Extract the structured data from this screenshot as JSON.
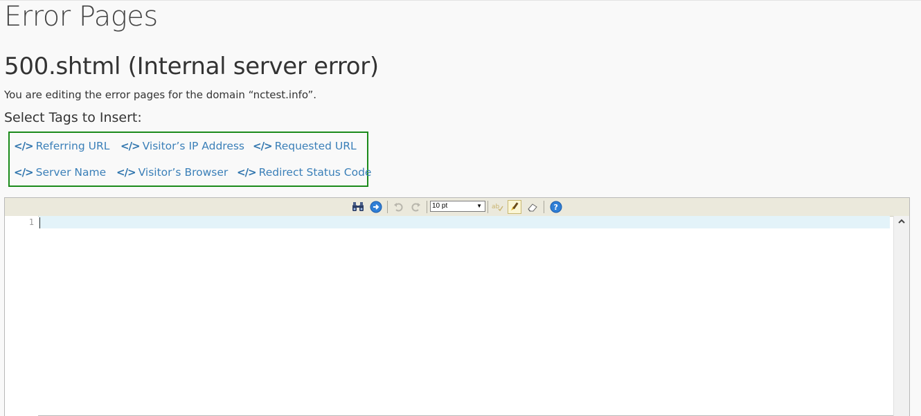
{
  "page": {
    "title": "Error Pages",
    "section_title": "500.shtml (Internal server error)",
    "description": "You are editing the error pages for the domain “nctest.info”.",
    "tags_heading": "Select Tags to Insert:"
  },
  "tags": {
    "icon": "</>",
    "items": [
      "Referring URL",
      "Visitor’s IP Address",
      "Requested URL",
      "Server Name",
      "Visitor’s Browser",
      "Redirect Status Code"
    ]
  },
  "editor": {
    "font_size": "10 pt",
    "line_numbers": [
      "1"
    ],
    "content": "",
    "toolbar_icons": [
      "search-icon",
      "go-to-line-icon",
      "undo-icon",
      "redo-icon",
      "font-size-select",
      "spellcheck-icon",
      "highlight-icon",
      "reset-icon",
      "help-icon"
    ]
  },
  "colors": {
    "tag_border": "#1a8a1a",
    "tag_link": "#3a7fb8",
    "line_highlight": "#e3f3f9"
  }
}
